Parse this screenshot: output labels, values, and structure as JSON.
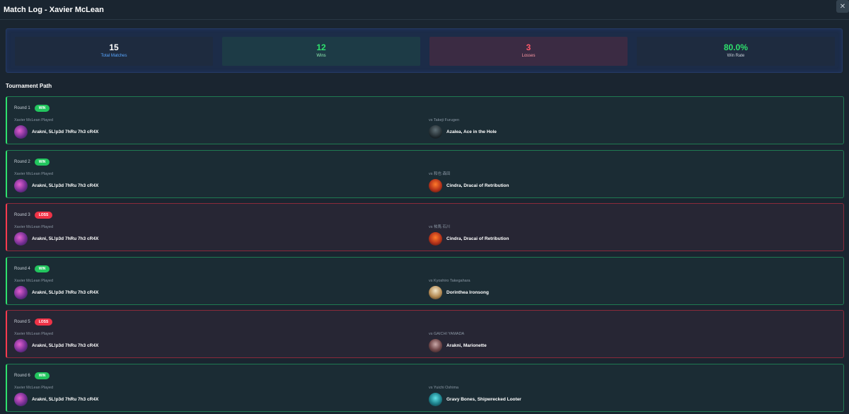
{
  "header": {
    "title": "Match Log - Xavier McLean",
    "close_label": "✕"
  },
  "stats": {
    "total": {
      "value": "15",
      "label": "Total Matches"
    },
    "wins": {
      "value": "12",
      "label": "Wins"
    },
    "losses": {
      "value": "3",
      "label": "Losses"
    },
    "win_rate": {
      "value": "80.0%",
      "label": "Win Rate"
    }
  },
  "section_title": "Tournament Path",
  "rounds": [
    {
      "round": "Round 1",
      "result": "WIN",
      "player_label": "Xavier McLean Played",
      "player_hero": "Arakni, 5L!p3d 7hRu 7h3 cR4X",
      "opponent_label": "vs Takeji Furugen",
      "opponent_hero": "Azalea, Ace in the Hole"
    },
    {
      "round": "Round 2",
      "result": "WIN",
      "player_label": "Xavier McLean Played",
      "player_hero": "Arakni, 5L!p3d 7hRu 7h3 cR4X",
      "opponent_label": "vs 和也 森田",
      "opponent_hero": "Cindra, Dracai of Retribution"
    },
    {
      "round": "Round 3",
      "result": "LOSS",
      "player_label": "Xavier McLean Played",
      "player_hero": "Arakni, 5L!p3d 7hRu 7h3 cR4X",
      "opponent_label": "vs 祐馬 石川",
      "opponent_hero": "Cindra, Dracai of Retribution"
    },
    {
      "round": "Round 4",
      "result": "WIN",
      "player_label": "Xavier McLean Played",
      "player_hero": "Arakni, 5L!p3d 7hRu 7h3 cR4X",
      "opponent_label": "vs Kyoshiro Takegahara",
      "opponent_hero": "Dorinthea Ironsong"
    },
    {
      "round": "Round 5",
      "result": "LOSS",
      "player_label": "Xavier McLean Played",
      "player_hero": "Arakni, 5L!p3d 7hRu 7h3 cR4X",
      "opponent_label": "vs GAICHI YAMADA",
      "opponent_hero": "Arakni, Marionette"
    },
    {
      "round": "Round 6",
      "result": "WIN",
      "player_label": "Xavier McLean Played",
      "player_hero": "Arakni, 5L!p3d 7hRu 7h3 cR4X",
      "opponent_label": "vs Yuichi Oshima",
      "opponent_hero": "Gravy Bones, Shipwrecked Looter"
    }
  ]
}
